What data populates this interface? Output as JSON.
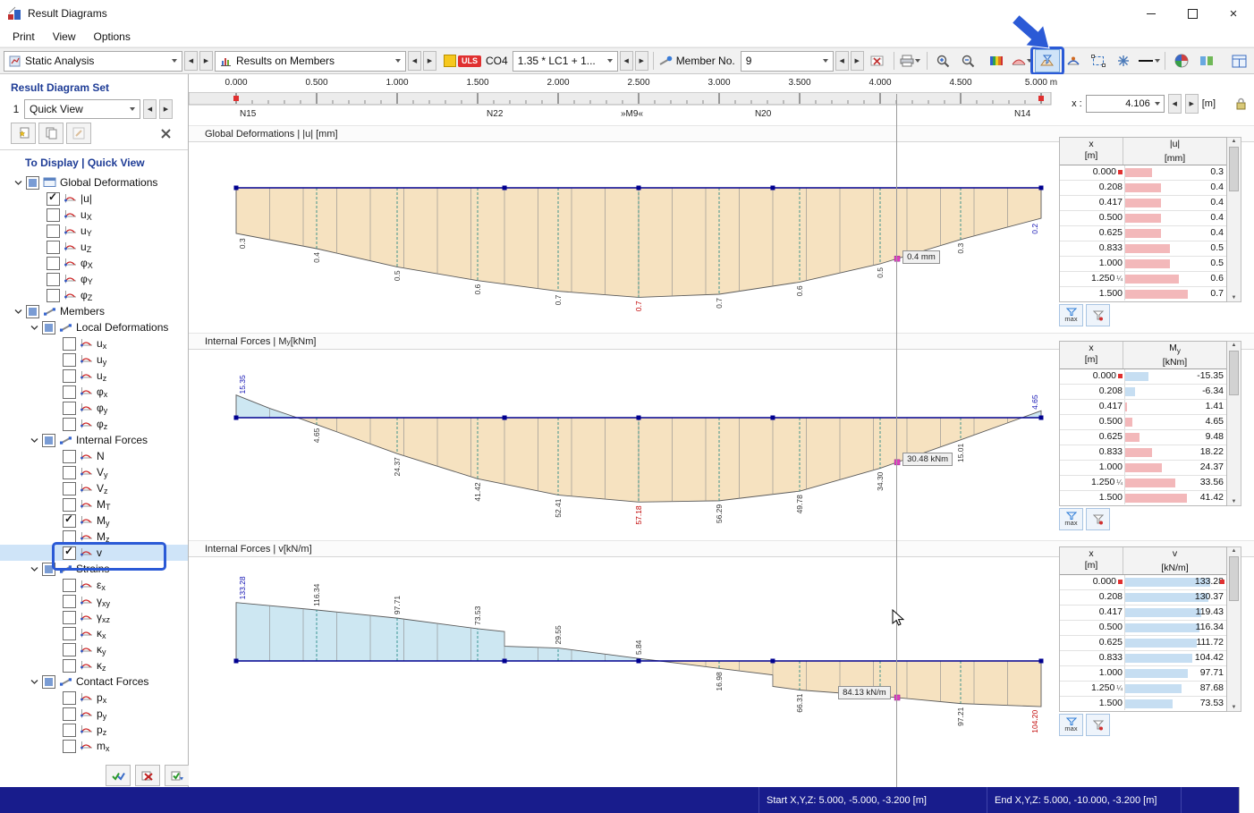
{
  "window": {
    "title": "Result Diagrams",
    "menu": [
      "Print",
      "View",
      "Options"
    ]
  },
  "toolbar": {
    "analysis_type": "Static Analysis",
    "results_category": "Results on Members",
    "uls_badge": "ULS",
    "co_label": "CO4",
    "load_combination": "1.35 * LC1 + 1...",
    "member_label": "Member No.",
    "member_no": "9",
    "icons": [
      "printer",
      "zoom-in",
      "zoom-out",
      "color-scale",
      "result-values",
      "result-diagram-filter",
      "deformation",
      "clipping-box",
      "snap-cross",
      "line-style",
      "palette",
      "display-options",
      "panel-grid",
      "delete-result",
      "lock"
    ]
  },
  "sidebar": {
    "title": "Result Diagram Set",
    "set_number": "1",
    "set_name": "Quick View",
    "tree": {
      "title": "To Display | Quick View",
      "items": [
        {
          "level": 0,
          "group": true,
          "check": "mixed",
          "icon": "screen",
          "base": "Global Deformations",
          "sub": ""
        },
        {
          "level": 1,
          "check": "on",
          "icon": "diagram",
          "base": "|u|",
          "sub": ""
        },
        {
          "level": 1,
          "check": "off",
          "icon": "diagram",
          "base": "u",
          "sub": "X"
        },
        {
          "level": 1,
          "check": "off",
          "icon": "diagram",
          "base": "u",
          "sub": "Y"
        },
        {
          "level": 1,
          "check": "off",
          "icon": "diagram",
          "base": "u",
          "sub": "Z"
        },
        {
          "level": 1,
          "check": "off",
          "icon": "diagram",
          "base": "φ",
          "sub": "X"
        },
        {
          "level": 1,
          "check": "off",
          "icon": "diagram",
          "base": "φ",
          "sub": "Y"
        },
        {
          "level": 1,
          "check": "off",
          "icon": "diagram",
          "base": "φ",
          "sub": "Z"
        },
        {
          "level": 0,
          "group": true,
          "check": "mixed",
          "icon": "member",
          "base": "Members",
          "sub": ""
        },
        {
          "level": 1,
          "group": true,
          "check": "mixed",
          "icon": "member",
          "base": "Local Deformations",
          "sub": ""
        },
        {
          "level": 2,
          "check": "off",
          "icon": "diagram",
          "base": "u",
          "sub": "x"
        },
        {
          "level": 2,
          "check": "off",
          "icon": "diagram",
          "base": "u",
          "sub": "y"
        },
        {
          "level": 2,
          "check": "off",
          "icon": "diagram",
          "base": "u",
          "sub": "z"
        },
        {
          "level": 2,
          "check": "off",
          "icon": "diagram",
          "base": "φ",
          "sub": "x"
        },
        {
          "level": 2,
          "check": "off",
          "icon": "diagram",
          "base": "φ",
          "sub": "y"
        },
        {
          "level": 2,
          "check": "off",
          "icon": "diagram",
          "base": "φ",
          "sub": "z"
        },
        {
          "level": 1,
          "group": true,
          "check": "mixed",
          "icon": "member",
          "base": "Internal Forces",
          "sub": ""
        },
        {
          "level": 2,
          "check": "off",
          "icon": "diagram",
          "base": "N",
          "sub": ""
        },
        {
          "level": 2,
          "check": "off",
          "icon": "diagram",
          "base": "V",
          "sub": "y"
        },
        {
          "level": 2,
          "check": "off",
          "icon": "diagram",
          "base": "V",
          "sub": "z"
        },
        {
          "level": 2,
          "check": "off",
          "icon": "diagram",
          "base": "M",
          "sub": "T"
        },
        {
          "level": 2,
          "check": "on",
          "icon": "diagram",
          "base": "M",
          "sub": "y"
        },
        {
          "level": 2,
          "check": "off",
          "icon": "diagram",
          "base": "M",
          "sub": "z"
        },
        {
          "level": 2,
          "check": "on",
          "icon": "diagram",
          "base": "v",
          "sub": "",
          "selected": true
        },
        {
          "level": 1,
          "group": true,
          "check": "mixed",
          "icon": "member",
          "base": "Strains",
          "sub": ""
        },
        {
          "level": 2,
          "check": "off",
          "icon": "diagram",
          "base": "ε",
          "sub": "x"
        },
        {
          "level": 2,
          "check": "off",
          "icon": "diagram",
          "base": "γ",
          "sub": "xy"
        },
        {
          "level": 2,
          "check": "off",
          "icon": "diagram",
          "base": "γ",
          "sub": "xz"
        },
        {
          "level": 2,
          "check": "off",
          "icon": "diagram",
          "base": "κ",
          "sub": "x"
        },
        {
          "level": 2,
          "check": "off",
          "icon": "diagram",
          "base": "κ",
          "sub": "y"
        },
        {
          "level": 2,
          "check": "off",
          "icon": "diagram",
          "base": "κ",
          "sub": "z"
        },
        {
          "level": 1,
          "group": true,
          "check": "mixed",
          "icon": "member",
          "base": "Contact Forces",
          "sub": ""
        },
        {
          "level": 2,
          "check": "off",
          "icon": "diagram",
          "base": "p",
          "sub": "x"
        },
        {
          "level": 2,
          "check": "off",
          "icon": "diagram",
          "base": "p",
          "sub": "y"
        },
        {
          "level": 2,
          "check": "off",
          "icon": "diagram",
          "base": "p",
          "sub": "z"
        },
        {
          "level": 2,
          "check": "off",
          "icon": "diagram",
          "base": "m",
          "sub": "x"
        }
      ]
    }
  },
  "ruler": {
    "ticks": [
      "0.000",
      "0.500",
      "1.000",
      "1.500",
      "2.000",
      "2.500",
      "3.000",
      "3.500",
      "4.000",
      "4.500",
      "5.000 m"
    ],
    "nodes": [
      {
        "pos": 0,
        "label": "N15",
        "align": "start"
      },
      {
        "pos": 1.667,
        "label": "N22",
        "align": "center"
      },
      {
        "pos": 2.5,
        "label": "»M9«",
        "align": "center"
      },
      {
        "pos": 3.333,
        "label": "N20",
        "align": "center"
      },
      {
        "pos": 5,
        "label": "N14",
        "align": "end"
      }
    ],
    "node_positions": [
      0,
      1.667,
      2.5,
      3.333,
      5
    ],
    "x_label": "x :",
    "x_value": "4.106",
    "x_unit": "[m]"
  },
  "panels": [
    {
      "pre": "Global Deformations | |u| [mm]",
      "sub": "",
      "post": ""
    },
    {
      "pre": "Internal Forces | M",
      "sub": "y",
      "post": " [kNm]"
    },
    {
      "pre": "Internal Forces | v",
      "sub": "",
      "post": " [kN/m]"
    }
  ],
  "chart_data": [
    {
      "type": "area",
      "title": "Global Deformations | |u| [mm]",
      "unit": "mm",
      "x_range": [
        0,
        5
      ],
      "value_range": [
        0,
        0.72
      ],
      "positive_direction": "down",
      "positive_color": "#f6e2c0",
      "negative_color": "#cde7f2",
      "points": [
        [
          0,
          0.3
        ],
        [
          0.5,
          0.4
        ],
        [
          1,
          0.52
        ],
        [
          1.5,
          0.61
        ],
        [
          2,
          0.68
        ],
        [
          2.5,
          0.72
        ],
        [
          3,
          0.7
        ],
        [
          3.5,
          0.62
        ],
        [
          4,
          0.5
        ],
        [
          4.5,
          0.34
        ],
        [
          5,
          0.2
        ]
      ],
      "labels": [
        {
          "x": 0.04,
          "t": "0.3",
          "c": "black"
        },
        {
          "x": 0.5,
          "t": "0.4",
          "c": "black"
        },
        {
          "x": 1,
          "t": "0.5",
          "c": "black"
        },
        {
          "x": 1.5,
          "t": "0.6",
          "c": "black"
        },
        {
          "x": 2,
          "t": "0.7",
          "c": "black"
        },
        {
          "x": 2.5,
          "t": "0.7",
          "c": "red"
        },
        {
          "x": 3,
          "t": "0.7",
          "c": "black"
        },
        {
          "x": 3.5,
          "t": "0.6",
          "c": "black"
        },
        {
          "x": 4,
          "t": "0.5",
          "c": "black"
        },
        {
          "x": 4.5,
          "t": "0.3",
          "c": "black"
        },
        {
          "x": 4.96,
          "t": "0.2",
          "c": "blue"
        }
      ],
      "marker": {
        "x": 4.106,
        "tooltip": "0.4 mm"
      }
    },
    {
      "type": "area",
      "title": "Internal Forces | My [kNm]",
      "unit": "kNm",
      "x_range": [
        0,
        5
      ],
      "value_range": [
        -15.35,
        57.18
      ],
      "positive_direction": "down",
      "positive_color": "#f6e2c0",
      "negative_color": "#cde7f2",
      "points": [
        [
          0,
          -15.35
        ],
        [
          0.208,
          -6.34
        ],
        [
          0.417,
          1.41
        ],
        [
          0.5,
          4.65
        ],
        [
          1,
          24.37
        ],
        [
          1.5,
          41.42
        ],
        [
          2,
          52.41
        ],
        [
          2.5,
          57.18
        ],
        [
          3,
          56.29
        ],
        [
          3.5,
          49.78
        ],
        [
          4,
          34.3
        ],
        [
          4.5,
          15.01
        ],
        [
          5,
          -4.65
        ]
      ],
      "labels": [
        {
          "x": 0.04,
          "t": "15.35",
          "c": "blue"
        },
        {
          "x": 0.5,
          "t": "4.65",
          "c": "black"
        },
        {
          "x": 1,
          "t": "24.37",
          "c": "black"
        },
        {
          "x": 1.5,
          "t": "41.42",
          "c": "black"
        },
        {
          "x": 2,
          "t": "52.41",
          "c": "black"
        },
        {
          "x": 2.5,
          "t": "57.18",
          "c": "red"
        },
        {
          "x": 3,
          "t": "56.29",
          "c": "black"
        },
        {
          "x": 3.5,
          "t": "49.78",
          "c": "black"
        },
        {
          "x": 4,
          "t": "34.30",
          "c": "black"
        },
        {
          "x": 4.5,
          "t": "15.01",
          "c": "black"
        },
        {
          "x": 4.96,
          "t": "4.65",
          "c": "blue"
        }
      ],
      "marker": {
        "x": 4.106,
        "tooltip": "30.48 kNm"
      }
    },
    {
      "type": "area",
      "title": "Internal Forces | v [kN/m]",
      "unit": "kN/m",
      "x_range": [
        0,
        5
      ],
      "value_range": [
        -104.2,
        133.28
      ],
      "positive_direction": "up",
      "positive_color": "#cde7f2",
      "negative_color": "#f6e2c0",
      "points": [
        [
          0,
          133.28
        ],
        [
          0.5,
          116.34
        ],
        [
          1,
          97.71
        ],
        [
          1.5,
          73.53
        ],
        [
          1.667,
          67.0
        ],
        [
          1.667,
          33.5
        ],
        [
          2,
          29.55
        ],
        [
          2.5,
          5.84
        ],
        [
          2.63,
          0
        ],
        [
          3,
          -16.98
        ],
        [
          3.333,
          -32.0
        ],
        [
          3.333,
          -58.0
        ],
        [
          3.5,
          -66.31
        ],
        [
          4,
          -80.0
        ],
        [
          4.5,
          -97.21
        ],
        [
          5,
          -104.2
        ]
      ],
      "labels": [
        {
          "x": 0.04,
          "t": "133.28",
          "c": "blue"
        },
        {
          "x": 0.5,
          "t": "116.34",
          "c": "black"
        },
        {
          "x": 1,
          "t": "97.71",
          "c": "black"
        },
        {
          "x": 1.5,
          "t": "73.53",
          "c": "black"
        },
        {
          "x": 2,
          "t": "29.55",
          "c": "black"
        },
        {
          "x": 2.5,
          "t": "5.84",
          "c": "black"
        },
        {
          "x": 3,
          "t": "16.98",
          "c": "black"
        },
        {
          "x": 3.5,
          "t": "66.31",
          "c": "black"
        },
        {
          "x": 4.5,
          "t": "97.21",
          "c": "black"
        },
        {
          "x": 4.96,
          "t": "104.20",
          "c": "red"
        }
      ],
      "marker": {
        "x": 4.106,
        "tooltip": "84.13 kN/m"
      }
    }
  ],
  "table_controls": {
    "max_label": "max"
  },
  "tables": [
    {
      "hx": "x",
      "hxu": "[m]",
      "hv": "|u|",
      "hvsub": "",
      "hvu": "[mm]",
      "pos_bar": "pink",
      "full_scale": 1.0,
      "rows": [
        {
          "x": "0.000",
          "v": "0.3",
          "start": true
        },
        {
          "x": "0.208",
          "v": "0.4"
        },
        {
          "x": "0.417",
          "v": "0.4"
        },
        {
          "x": "0.500",
          "v": "0.4"
        },
        {
          "x": "0.625",
          "v": "0.4"
        },
        {
          "x": "0.833",
          "v": "0.5"
        },
        {
          "x": "1.000",
          "v": "0.5"
        },
        {
          "x": "1.250",
          "v": "0.6",
          "quarter": true
        },
        {
          "x": "1.500",
          "v": "0.7"
        }
      ]
    },
    {
      "hx": "x",
      "hxu": "[m]",
      "hv": "M",
      "hvsub": "y",
      "hvu": "[kNm]",
      "pos_bar": "pink",
      "full_scale": 60,
      "rows": [
        {
          "x": "0.000",
          "v": "-15.35",
          "start": true
        },
        {
          "x": "0.208",
          "v": "-6.34"
        },
        {
          "x": "0.417",
          "v": "1.41"
        },
        {
          "x": "0.500",
          "v": "4.65"
        },
        {
          "x": "0.625",
          "v": "9.48"
        },
        {
          "x": "0.833",
          "v": "18.22"
        },
        {
          "x": "1.000",
          "v": "24.37"
        },
        {
          "x": "1.250",
          "v": "33.56",
          "quarter": true
        },
        {
          "x": "1.500",
          "v": "41.42"
        }
      ]
    },
    {
      "hx": "x",
      "hxu": "[m]",
      "hv": "v",
      "hvsub": "",
      "hvu": "[kN/m]",
      "pos_bar": "blue",
      "full_scale": 140,
      "rows": [
        {
          "x": "0.000",
          "v": "133.28",
          "start": true,
          "endmark": true
        },
        {
          "x": "0.208",
          "v": "130.37"
        },
        {
          "x": "0.417",
          "v": "119.43"
        },
        {
          "x": "0.500",
          "v": "116.34"
        },
        {
          "x": "0.625",
          "v": "111.72"
        },
        {
          "x": "0.833",
          "v": "104.42"
        },
        {
          "x": "1.000",
          "v": "97.71"
        },
        {
          "x": "1.250",
          "v": "87.68",
          "quarter": true
        },
        {
          "x": "1.500",
          "v": "73.53"
        }
      ]
    }
  ],
  "status": {
    "start": "Start X,Y,Z: 5.000, -5.000, -3.200 [m]",
    "end": "End X,Y,Z: 5.000, -10.000, -3.200 [m]"
  }
}
